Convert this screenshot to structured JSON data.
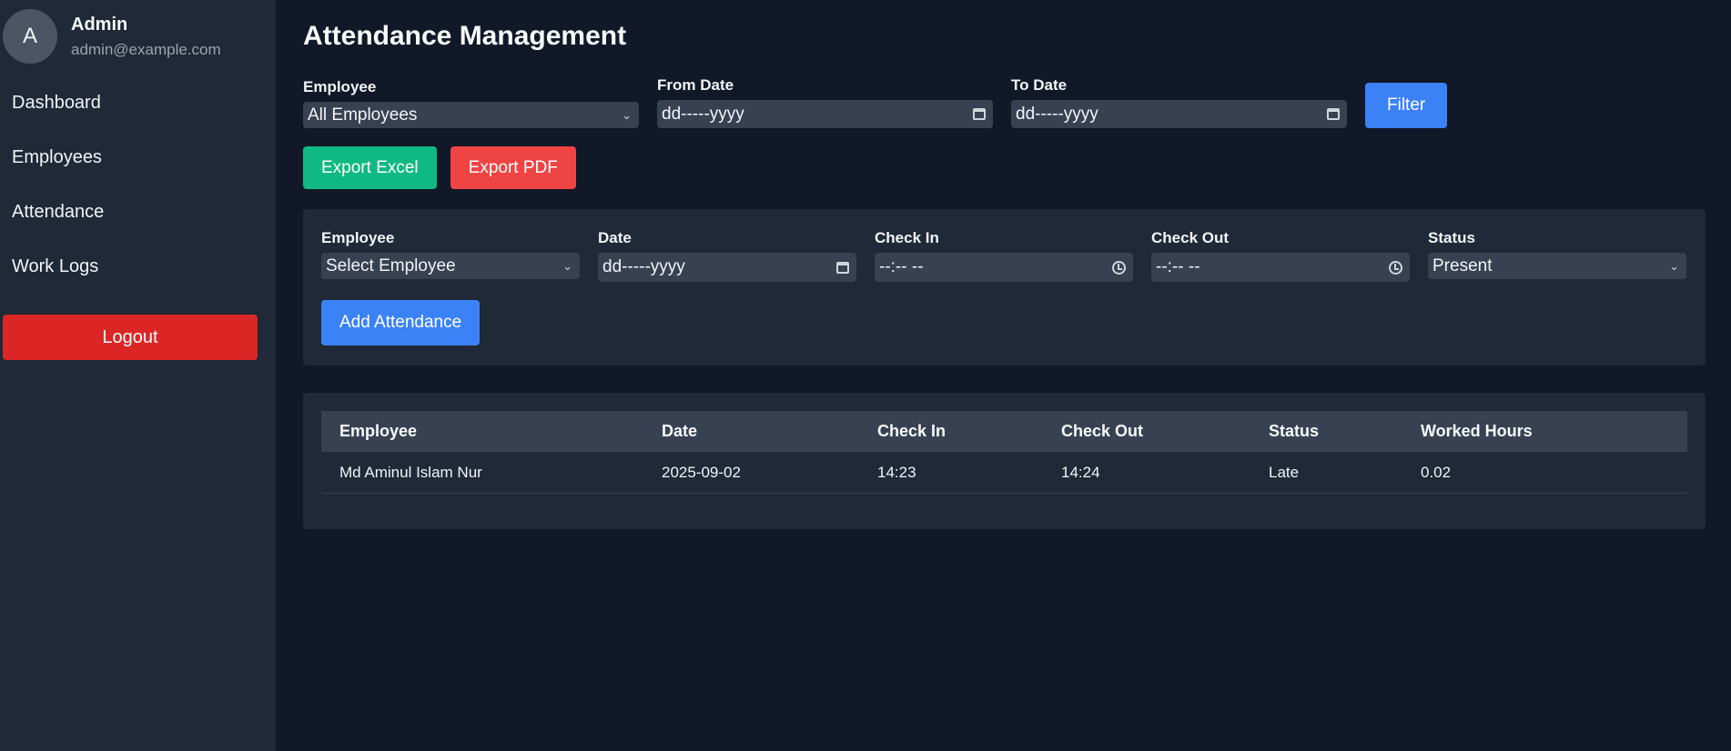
{
  "sidebar": {
    "avatar_letter": "A",
    "user_name": "Admin",
    "user_email": "admin@example.com",
    "nav": [
      "Dashboard",
      "Employees",
      "Attendance",
      "Work Logs"
    ],
    "logout_label": "Logout"
  },
  "page": {
    "title": "Attendance Management"
  },
  "filter": {
    "employee_label": "Employee",
    "employee_value": "All Employees",
    "from_label": "From Date",
    "from_placeholder": "dd-----yyyy",
    "to_label": "To Date",
    "to_placeholder": "dd-----yyyy",
    "filter_button": "Filter"
  },
  "export": {
    "excel_label": "Export Excel",
    "pdf_label": "Export PDF"
  },
  "add_form": {
    "employee_label": "Employee",
    "employee_value": "Select Employee",
    "date_label": "Date",
    "date_placeholder": "dd-----yyyy",
    "checkin_label": "Check In",
    "checkin_placeholder": "--:-- --",
    "checkout_label": "Check Out",
    "checkout_placeholder": "--:-- --",
    "status_label": "Status",
    "status_value": "Present",
    "add_button": "Add Attendance"
  },
  "table": {
    "headers": [
      "Employee",
      "Date",
      "Check In",
      "Check Out",
      "Status",
      "Worked Hours"
    ],
    "rows": [
      [
        "Md Aminul Islam Nur",
        "2025-09-02",
        "14:23",
        "14:24",
        "Late",
        "0.02"
      ]
    ]
  },
  "colors": {
    "background": "#111827",
    "sidebar": "#1f2937",
    "accent_blue": "#3b82f6",
    "export_green": "#10b981",
    "export_red": "#ef4444",
    "logout_red": "#dc2626"
  }
}
